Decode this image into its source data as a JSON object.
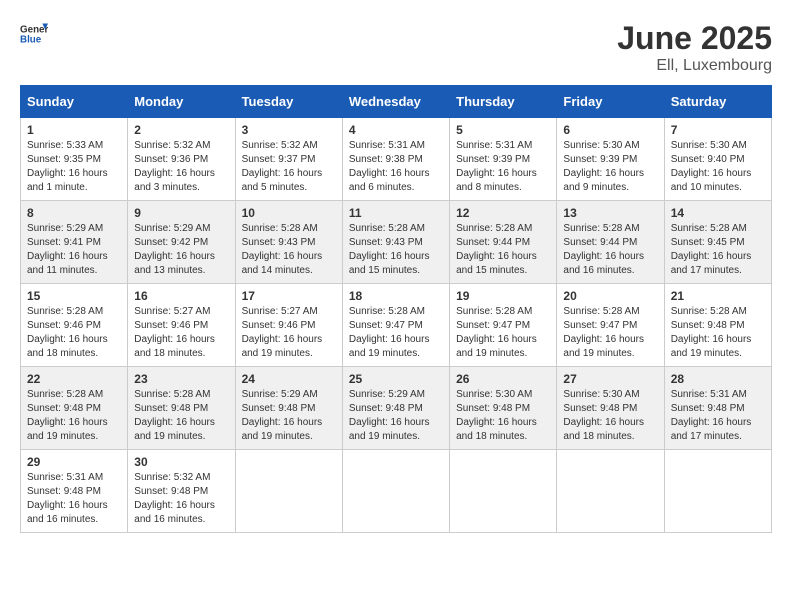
{
  "header": {
    "logo_general": "General",
    "logo_blue": "Blue",
    "month_title": "June 2025",
    "location": "Ell, Luxembourg"
  },
  "days_of_week": [
    "Sunday",
    "Monday",
    "Tuesday",
    "Wednesday",
    "Thursday",
    "Friday",
    "Saturday"
  ],
  "weeks": [
    [
      {
        "day": "1",
        "sunrise": "5:33 AM",
        "sunset": "9:35 PM",
        "daylight": "16 hours and 1 minute."
      },
      {
        "day": "2",
        "sunrise": "5:32 AM",
        "sunset": "9:36 PM",
        "daylight": "16 hours and 3 minutes."
      },
      {
        "day": "3",
        "sunrise": "5:32 AM",
        "sunset": "9:37 PM",
        "daylight": "16 hours and 5 minutes."
      },
      {
        "day": "4",
        "sunrise": "5:31 AM",
        "sunset": "9:38 PM",
        "daylight": "16 hours and 6 minutes."
      },
      {
        "day": "5",
        "sunrise": "5:31 AM",
        "sunset": "9:39 PM",
        "daylight": "16 hours and 8 minutes."
      },
      {
        "day": "6",
        "sunrise": "5:30 AM",
        "sunset": "9:39 PM",
        "daylight": "16 hours and 9 minutes."
      },
      {
        "day": "7",
        "sunrise": "5:30 AM",
        "sunset": "9:40 PM",
        "daylight": "16 hours and 10 minutes."
      }
    ],
    [
      {
        "day": "8",
        "sunrise": "5:29 AM",
        "sunset": "9:41 PM",
        "daylight": "16 hours and 11 minutes."
      },
      {
        "day": "9",
        "sunrise": "5:29 AM",
        "sunset": "9:42 PM",
        "daylight": "16 hours and 13 minutes."
      },
      {
        "day": "10",
        "sunrise": "5:28 AM",
        "sunset": "9:43 PM",
        "daylight": "16 hours and 14 minutes."
      },
      {
        "day": "11",
        "sunrise": "5:28 AM",
        "sunset": "9:43 PM",
        "daylight": "16 hours and 15 minutes."
      },
      {
        "day": "12",
        "sunrise": "5:28 AM",
        "sunset": "9:44 PM",
        "daylight": "16 hours and 15 minutes."
      },
      {
        "day": "13",
        "sunrise": "5:28 AM",
        "sunset": "9:44 PM",
        "daylight": "16 hours and 16 minutes."
      },
      {
        "day": "14",
        "sunrise": "5:28 AM",
        "sunset": "9:45 PM",
        "daylight": "16 hours and 17 minutes."
      }
    ],
    [
      {
        "day": "15",
        "sunrise": "5:28 AM",
        "sunset": "9:46 PM",
        "daylight": "16 hours and 18 minutes."
      },
      {
        "day": "16",
        "sunrise": "5:27 AM",
        "sunset": "9:46 PM",
        "daylight": "16 hours and 18 minutes."
      },
      {
        "day": "17",
        "sunrise": "5:27 AM",
        "sunset": "9:46 PM",
        "daylight": "16 hours and 19 minutes."
      },
      {
        "day": "18",
        "sunrise": "5:28 AM",
        "sunset": "9:47 PM",
        "daylight": "16 hours and 19 minutes."
      },
      {
        "day": "19",
        "sunrise": "5:28 AM",
        "sunset": "9:47 PM",
        "daylight": "16 hours and 19 minutes."
      },
      {
        "day": "20",
        "sunrise": "5:28 AM",
        "sunset": "9:47 PM",
        "daylight": "16 hours and 19 minutes."
      },
      {
        "day": "21",
        "sunrise": "5:28 AM",
        "sunset": "9:48 PM",
        "daylight": "16 hours and 19 minutes."
      }
    ],
    [
      {
        "day": "22",
        "sunrise": "5:28 AM",
        "sunset": "9:48 PM",
        "daylight": "16 hours and 19 minutes."
      },
      {
        "day": "23",
        "sunrise": "5:28 AM",
        "sunset": "9:48 PM",
        "daylight": "16 hours and 19 minutes."
      },
      {
        "day": "24",
        "sunrise": "5:29 AM",
        "sunset": "9:48 PM",
        "daylight": "16 hours and 19 minutes."
      },
      {
        "day": "25",
        "sunrise": "5:29 AM",
        "sunset": "9:48 PM",
        "daylight": "16 hours and 19 minutes."
      },
      {
        "day": "26",
        "sunrise": "5:30 AM",
        "sunset": "9:48 PM",
        "daylight": "16 hours and 18 minutes."
      },
      {
        "day": "27",
        "sunrise": "5:30 AM",
        "sunset": "9:48 PM",
        "daylight": "16 hours and 18 minutes."
      },
      {
        "day": "28",
        "sunrise": "5:31 AM",
        "sunset": "9:48 PM",
        "daylight": "16 hours and 17 minutes."
      }
    ],
    [
      {
        "day": "29",
        "sunrise": "5:31 AM",
        "sunset": "9:48 PM",
        "daylight": "16 hours and 16 minutes."
      },
      {
        "day": "30",
        "sunrise": "5:32 AM",
        "sunset": "9:48 PM",
        "daylight": "16 hours and 16 minutes."
      },
      null,
      null,
      null,
      null,
      null
    ]
  ],
  "labels": {
    "sunrise_prefix": "Sunrise: ",
    "sunset_prefix": "Sunset: ",
    "daylight_prefix": "Daylight: "
  }
}
